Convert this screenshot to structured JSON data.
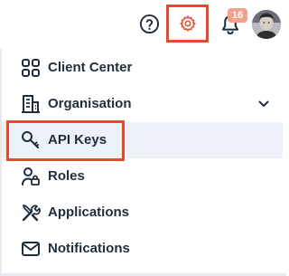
{
  "topbar": {
    "help_icon": "question-circle-icon",
    "settings_icon": "gear-icon",
    "notifications_icon": "bell-icon",
    "notification_count": "16",
    "avatar": "user-avatar"
  },
  "menu": {
    "items": [
      {
        "label": "Client Center",
        "icon": "grid-four-squares-icon",
        "active": false,
        "expandable": false
      },
      {
        "label": "Organisation",
        "icon": "building-icon",
        "active": false,
        "expandable": true
      },
      {
        "label": "API Keys",
        "icon": "key-icon",
        "active": true,
        "expandable": false
      },
      {
        "label": "Roles",
        "icon": "user-lock-icon",
        "active": false,
        "expandable": false
      },
      {
        "label": "Applications",
        "icon": "tools-icon",
        "active": false,
        "expandable": false
      },
      {
        "label": "Notifications",
        "icon": "envelope-icon",
        "active": false,
        "expandable": false
      }
    ]
  },
  "colors": {
    "highlight": "#e5492a",
    "badge": "#f4a08c",
    "active_row": "#edf2f8",
    "text": "#1f2d3d"
  }
}
